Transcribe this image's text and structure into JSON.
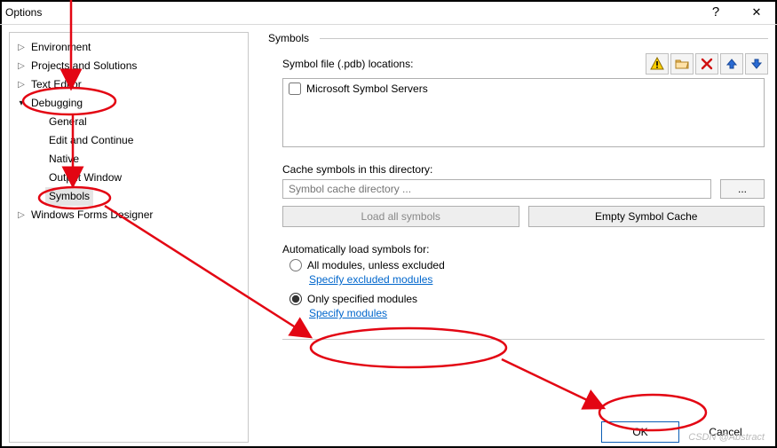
{
  "window": {
    "title": "Options",
    "help_glyph": "?",
    "close_glyph": "✕"
  },
  "tree": {
    "items": [
      {
        "label": "Environment",
        "expandable": true,
        "expanded": false
      },
      {
        "label": "Projects and Solutions",
        "expandable": true,
        "expanded": false
      },
      {
        "label": "Text Editor",
        "expandable": true,
        "expanded": false
      },
      {
        "label": "Debugging",
        "expandable": true,
        "expanded": true,
        "children": [
          {
            "label": "General"
          },
          {
            "label": "Edit and Continue"
          },
          {
            "label": "Native"
          },
          {
            "label": "Output Window"
          },
          {
            "label": "Symbols",
            "selected": true
          }
        ]
      },
      {
        "label": "Windows Forms Designer",
        "expandable": true,
        "expanded": false
      }
    ]
  },
  "symbols": {
    "section_title": "Symbols",
    "locations_label": "Symbol file (.pdb) locations:",
    "checkbox_label": "Microsoft Symbol Servers",
    "checkbox_checked": false,
    "toolbar": {
      "warn_icon": "warning-icon",
      "folder_icon": "open-folder-icon",
      "delete_icon": "delete-icon",
      "up_icon": "arrow-up-icon",
      "down_icon": "arrow-down-icon"
    },
    "cache_label": "Cache symbols in this directory:",
    "cache_placeholder": "Symbol cache directory ...",
    "cache_value": "",
    "browse_label": "...",
    "load_all_label": "Load all symbols",
    "empty_cache_label": "Empty Symbol Cache",
    "auto_label": "Automatically load symbols for:",
    "radio": {
      "all_label": "All modules, unless excluded",
      "only_label": "Only specified modules",
      "value": "only"
    },
    "link_excluded": "Specify excluded modules",
    "link_specified": "Specify modules"
  },
  "footer": {
    "ok_label": "OK",
    "cancel_label": "Cancel"
  },
  "annotations": {
    "color": "#e30613",
    "ellipses": [
      "debugging-node",
      "symbols-node",
      "only-specified-radio",
      "ok-button"
    ]
  },
  "watermark": "CSDN @Abstract"
}
